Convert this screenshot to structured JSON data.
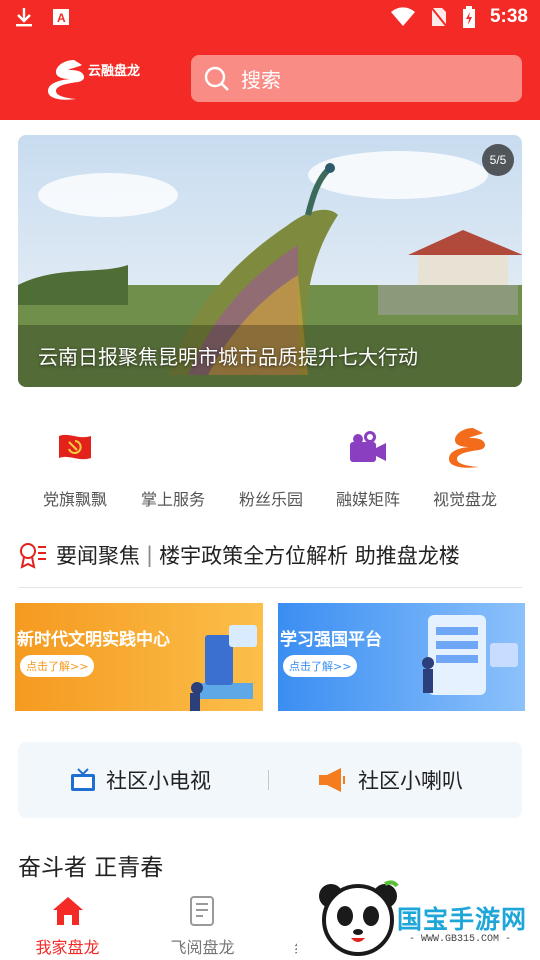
{
  "status_bar": {
    "time": "5:38"
  },
  "header": {
    "logo_text": "云融盘龙",
    "search_placeholder": "搜索"
  },
  "banner": {
    "counter": "5/5",
    "caption": "云南日报聚焦昆明市城市品质提升七大行动"
  },
  "quick_nav": [
    {
      "label": "党旗飘飘",
      "icon": "party-flag-icon"
    },
    {
      "label": "掌上服务",
      "icon": "service-icon"
    },
    {
      "label": "粉丝乐园",
      "icon": "fans-icon"
    },
    {
      "label": "融媒矩阵",
      "icon": "video-camera-icon"
    },
    {
      "label": "视觉盘龙",
      "icon": "dragon-logo-icon"
    }
  ],
  "headline": {
    "title": "要闻聚焦",
    "text": "楼宇政策全方位解析 助推盘龙楼"
  },
  "promos": [
    {
      "title": "新时代文明实践中心",
      "button": "点击了解>>",
      "color": "#f7a325"
    },
    {
      "title": "学习强国平台",
      "button": "点击了解>>",
      "color": "#3b8ef0"
    }
  ],
  "community": [
    {
      "label": "社区小电视",
      "icon": "tv-icon"
    },
    {
      "label": "社区小喇叭",
      "icon": "megaphone-icon"
    }
  ],
  "section": {
    "title": "奋斗者 正青春"
  },
  "tabs": [
    {
      "label": "我家盘龙",
      "active": true
    },
    {
      "label": "飞阅盘龙",
      "active": false
    },
    {
      "label": "纟",
      "active": false
    }
  ],
  "watermark": {
    "title": "国宝手游网",
    "url": "- WWW.GB315.COM -"
  },
  "colors": {
    "brand_red": "#f32a25",
    "search_bg": "#f98c85"
  }
}
